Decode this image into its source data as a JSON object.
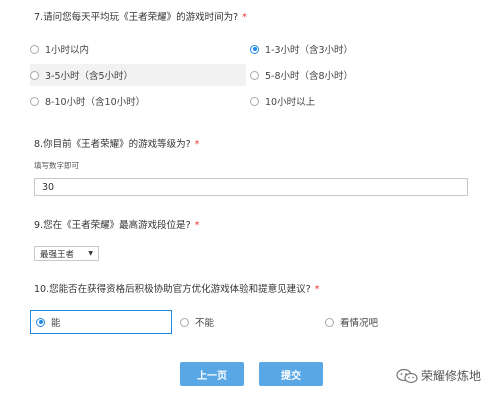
{
  "q7": {
    "title": "7.请问您每天平均玩《王者荣耀》的游戏时间为?",
    "required_mark": "*",
    "options": [
      "1小时以内",
      "1-3小时（含3小时）",
      "3-5小时（含5小时）",
      "5-8小时（含8小时）",
      "8-10小时（含10小时）",
      "10小时以上"
    ],
    "selected": "1-3小时（含3小时）"
  },
  "q8": {
    "title": "8.你目前《王者荣耀》的游戏等级为?",
    "required_mark": "*",
    "hint": "填写数字即可",
    "value": "30"
  },
  "q9": {
    "title": "9.您在《王者荣耀》最高游戏段位是?",
    "required_mark": "*",
    "selected": "最强王者"
  },
  "q10": {
    "title": "10.您能否在获得资格后积极协助官方优化游戏体验和提意见建议?",
    "required_mark": "*",
    "options": [
      "能",
      "不能",
      "看情况吧"
    ],
    "selected": "能"
  },
  "buttons": {
    "prev": "上一页",
    "submit": "提交"
  },
  "watermark": "荣耀修炼地",
  "colors": {
    "accent": "#1e88e5",
    "button": "#5aa7e6",
    "required": "#e33333"
  }
}
